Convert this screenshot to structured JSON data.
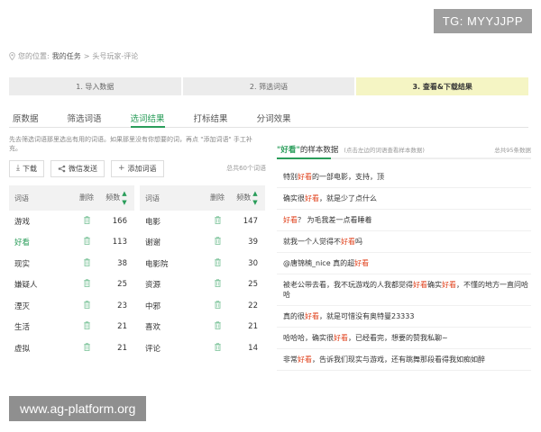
{
  "watermarks": {
    "top": "TG: MYYJJPP",
    "bottom": "www.ag-platform.org"
  },
  "breadcrumb": {
    "prefix": "您的位置:",
    "current": "我的任务",
    "separator": ">",
    "item": "头号玩家-评论"
  },
  "steps": [
    {
      "label": "1. 导入数据",
      "active": false
    },
    {
      "label": "2. 筛选词语",
      "active": false
    },
    {
      "label": "3. 查看&下载结果",
      "active": true
    }
  ],
  "tabs": [
    {
      "label": "原数据",
      "active": false
    },
    {
      "label": "筛选词语",
      "active": false
    },
    {
      "label": "选词结果",
      "active": true
    },
    {
      "label": "打标结果",
      "active": false
    },
    {
      "label": "分词效果",
      "active": false
    }
  ],
  "left": {
    "intro": "先去筛选词语那里选出有用的词语。如果那里没有你想要的词，再点 \"添加词语\" 手工补充。",
    "toolbar": {
      "download": "下载",
      "wechat": "微信发送",
      "add": "添加词语",
      "total": "总共60个词语"
    },
    "columns": {
      "word": "词语",
      "delete": "删除",
      "freq": "频数"
    },
    "left_rows": [
      {
        "word": "游戏",
        "freq": "166",
        "highlight": false
      },
      {
        "word": "好看",
        "freq": "113",
        "highlight": true
      },
      {
        "word": "现实",
        "freq": "38",
        "highlight": false
      },
      {
        "word": "嫌疑人",
        "freq": "25",
        "highlight": false
      },
      {
        "word": "湮灭",
        "freq": "23",
        "highlight": false
      },
      {
        "word": "生活",
        "freq": "21",
        "highlight": false
      },
      {
        "word": "虚拟",
        "freq": "21",
        "highlight": false
      }
    ],
    "right_rows": [
      {
        "word": "电影",
        "freq": "147",
        "highlight": false
      },
      {
        "word": "谢谢",
        "freq": "39",
        "highlight": false
      },
      {
        "word": "电影院",
        "freq": "30",
        "highlight": false
      },
      {
        "word": "资源",
        "freq": "25",
        "highlight": false
      },
      {
        "word": "中邪",
        "freq": "22",
        "highlight": false
      },
      {
        "word": "喜欢",
        "freq": "21",
        "highlight": false
      },
      {
        "word": "评论",
        "freq": "14",
        "highlight": false
      }
    ]
  },
  "right": {
    "keyword": "\"好看\"",
    "title_suffix": "的样本数据",
    "note": "(点击左边的词语查看样本数据)",
    "count": "总共95条数据",
    "samples": [
      [
        {
          "t": "特别"
        },
        {
          "t": "好看",
          "r": true
        },
        {
          "t": "的一部电影，支持，顶"
        }
      ],
      [
        {
          "t": "确实很"
        },
        {
          "t": "好看",
          "r": true
        },
        {
          "t": "，就是少了点什么"
        }
      ],
      [
        {
          "t": "好看",
          "r": true
        },
        {
          "t": "？ 为毛我差一点看睡着"
        }
      ],
      [
        {
          "t": "就我一个人觉得不"
        },
        {
          "t": "好看",
          "r": true
        },
        {
          "t": "吗"
        }
      ],
      [
        {
          "t": "@唐锦楠_nice 真的超"
        },
        {
          "t": "好看",
          "r": true
        }
      ],
      [
        {
          "t": "被老公带去看，我不玩游戏的人我都觉得"
        },
        {
          "t": "好看",
          "r": true
        },
        {
          "t": "确实"
        },
        {
          "t": "好看",
          "r": true
        },
        {
          "t": "，不懂的地方一直问哈哈"
        }
      ],
      [
        {
          "t": "真的很"
        },
        {
          "t": "好看",
          "r": true
        },
        {
          "t": "，就是可惜没有奥特曼23333"
        }
      ],
      [
        {
          "t": "哈哈哈，确实很"
        },
        {
          "t": "好看",
          "r": true
        },
        {
          "t": "，已经看完，想要的赞我私聊~"
        }
      ],
      [
        {
          "t": "非常"
        },
        {
          "t": "好看",
          "r": true
        },
        {
          "t": "，告诉我们现实与游戏，还有跳舞那段看得我如痴如醉"
        }
      ]
    ]
  }
}
